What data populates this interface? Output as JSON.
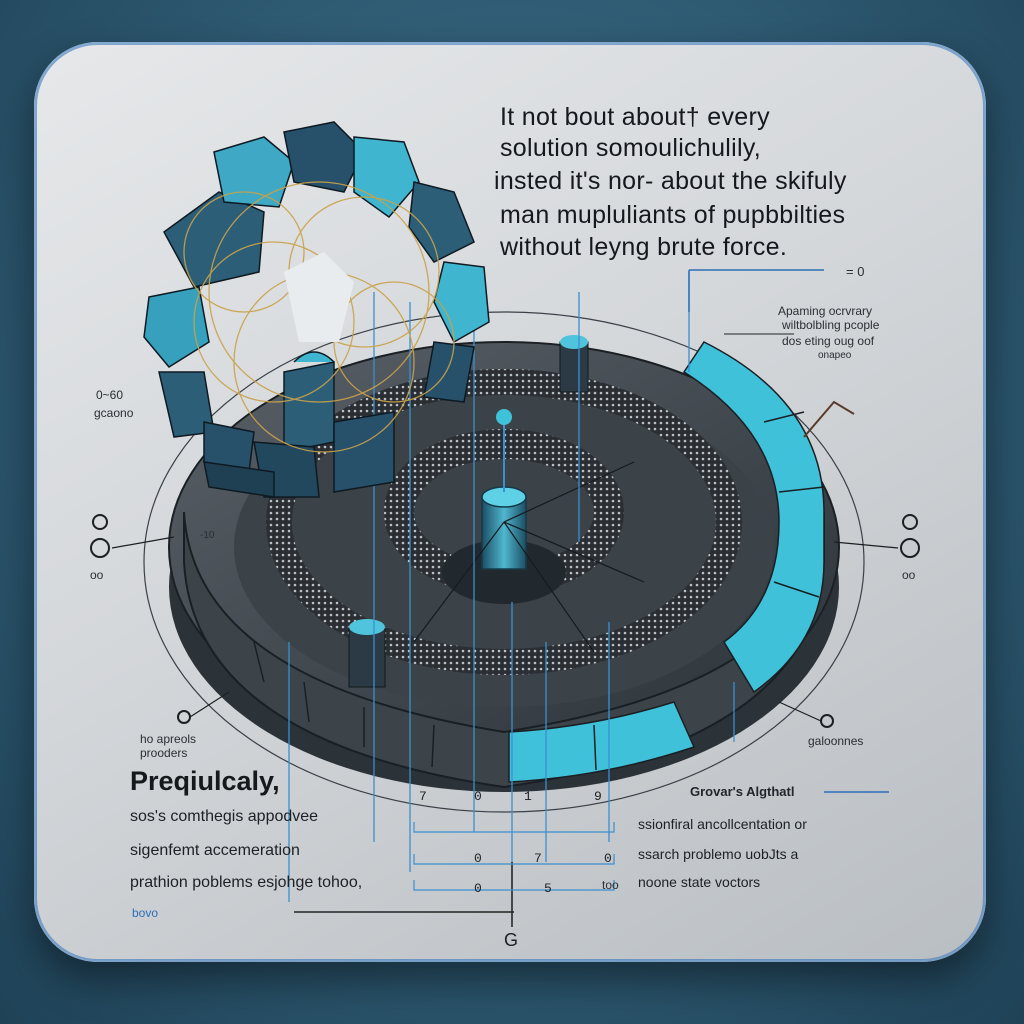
{
  "headline": {
    "line1": "It  not bout about† every",
    "line2": "solution somoulichulily,",
    "line3": "insted it's nor- about the skifuly",
    "line4": "man mupluliants of pupbbilties",
    "line5": "without leyng brute force."
  },
  "right_note": {
    "eq": "= 0",
    "line1": "Apaming ocrvrary",
    "line2": "wiltbolbling pcople",
    "line3": "dos eting oug oof",
    "line4": "onapeo"
  },
  "left_note": {
    "line1": "0~60",
    "line2": "gcaono"
  },
  "left_markers": {
    "m1": "o",
    "m2": "9",
    "m3": "oo",
    "tick": "-10"
  },
  "right_markers": {
    "m1": "o",
    "m2": "o",
    "m3": "oo"
  },
  "bottom_left": {
    "small1": "ho apreols",
    "small2": "prooders",
    "title": "Preqiulcaly,",
    "line1": "sos's comthegis appodvee",
    "line2": "sigenfemt accemeration",
    "line3": "prathion poblems esjohge tohoo,",
    "line4": "bovo"
  },
  "bottom_right": {
    "label": "galoonnes",
    "title": "Grovar's Algthatl",
    "line1": "ssionfiral ancollcentation or",
    "line2": "ssarch problemo uobJts a",
    "line3": "noone state voctors",
    "too": "too"
  },
  "bottom_letter": "G",
  "colors": {
    "accent": "#3fc1d9",
    "dark": "#23313c",
    "ring": "#2a3540",
    "line": "#3a8fcf"
  }
}
